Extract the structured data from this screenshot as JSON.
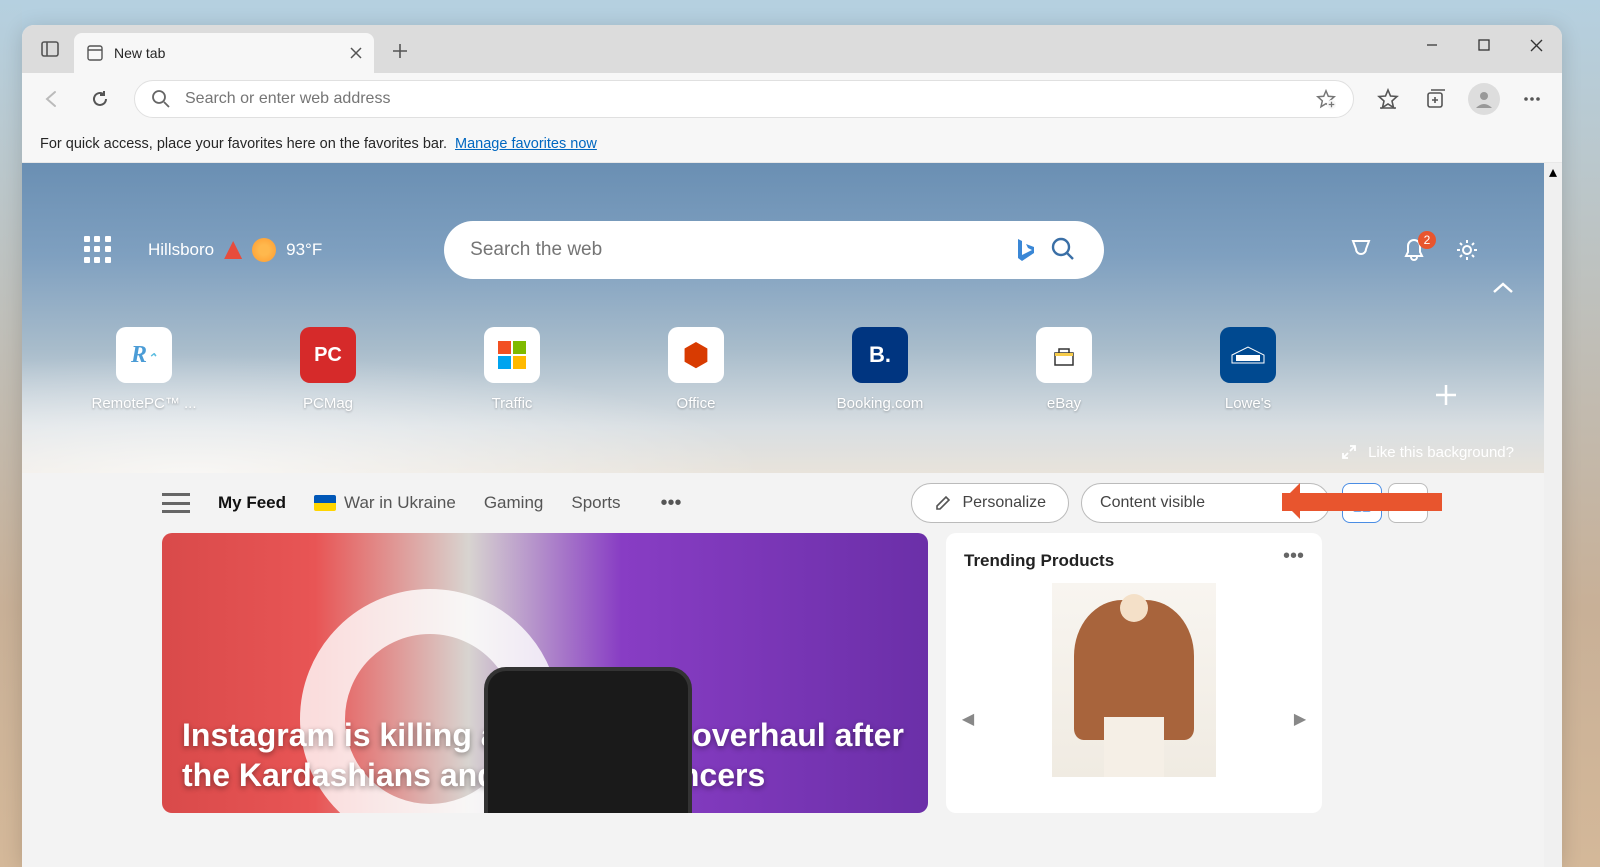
{
  "browser": {
    "tab_title": "New tab",
    "address_placeholder": "Search or enter web address",
    "favorites_message": "For quick access, place your favorites here on the favorites bar.",
    "manage_favorites_link": "Manage favorites now"
  },
  "hero": {
    "location": "Hillsboro",
    "temperature": "93°F",
    "search_placeholder": "Search the web",
    "notification_count": "2",
    "like_bg_text": "Like this background?"
  },
  "shortcuts": [
    {
      "label": "RemotePC™ ...",
      "tile": "R",
      "color": "#4b9cd6"
    },
    {
      "label": "PCMag",
      "tile": "PC",
      "color": "#d62a2a"
    },
    {
      "label": "Traffic",
      "tile": "",
      "color": ""
    },
    {
      "label": "Office",
      "tile": "O",
      "color": "#d83b01"
    },
    {
      "label": "Booking.com",
      "tile": "B.",
      "color": "#003580"
    },
    {
      "label": "eBay",
      "tile": "",
      "color": ""
    },
    {
      "label": "Lowe's",
      "tile": "",
      "color": "#004990"
    }
  ],
  "feed": {
    "tabs": [
      "My Feed",
      "War in Ukraine",
      "Gaming",
      "Sports"
    ],
    "personalize": "Personalize",
    "content_visible": "Content visible",
    "trending_title": "Trending Products",
    "headline": "Instagram is killing a big product overhaul after the Kardashians and other influencers"
  }
}
